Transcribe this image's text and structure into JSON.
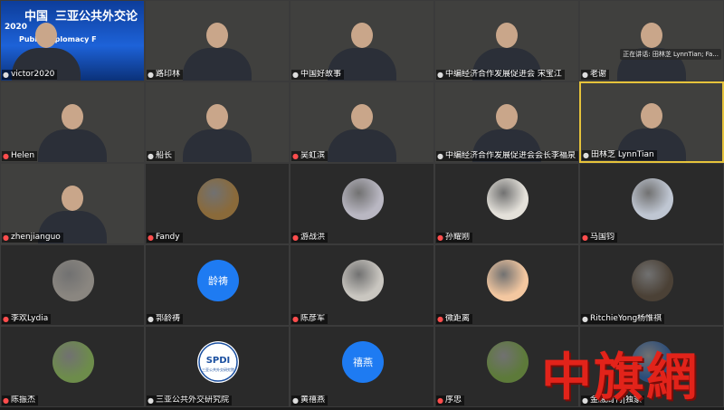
{
  "active_speaker": {
    "indicator_label": "正在讲话: 田林芝 LynnTian; Fa..."
  },
  "watermark": {
    "text": "中旗網"
  },
  "conference_banner": {
    "line1": "中国",
    "line2": "2020",
    "line3": "三亚公共外交论",
    "line4": "Public Diplomacy F"
  },
  "participants": [
    {
      "name": "victor2020",
      "kind": "banner",
      "muted": false
    },
    {
      "name": "路印林",
      "kind": "video",
      "bg": "dark",
      "muted": false
    },
    {
      "name": "中国好故事",
      "kind": "video",
      "bg": "stage",
      "muted": false
    },
    {
      "name": "中编经济合作发展促进会 宋宝江",
      "kind": "video",
      "bg": "flags",
      "muted": false
    },
    {
      "name": "老谢",
      "kind": "video",
      "bg": "outdoor",
      "muted": false
    },
    {
      "name": "Helen",
      "kind": "video",
      "bg": "light",
      "muted": true
    },
    {
      "name": "船长",
      "kind": "video",
      "bg": "office",
      "muted": false
    },
    {
      "name": "吴虹滨",
      "kind": "video",
      "bg": "shelf",
      "muted": true
    },
    {
      "name": "中编经济合作发展促进会会长李福泉",
      "kind": "video",
      "bg": "wall",
      "muted": false
    },
    {
      "name": "田林芝 LynnTian",
      "kind": "video",
      "bg": "wall",
      "muted": false,
      "active": true
    },
    {
      "name": "zhenjianguo",
      "kind": "video",
      "bg": "light",
      "muted": true
    },
    {
      "name": "Fandy",
      "kind": "avatar-image",
      "color": "#8a6a3a",
      "muted": true
    },
    {
      "name": "游战洪",
      "kind": "avatar-image",
      "color": "#b9b7c2",
      "muted": true
    },
    {
      "name": "孙耀刚",
      "kind": "avatar-image",
      "color": "#e4e1da",
      "muted": true
    },
    {
      "name": "马国钧",
      "kind": "avatar-image",
      "color": "#bfc6d2",
      "muted": true
    },
    {
      "name": "李欢Lydia",
      "kind": "avatar-image",
      "color": "#8a8680",
      "muted": true
    },
    {
      "name": "郭龄祷",
      "kind": "avatar-text",
      "initials": "龄祷",
      "muted": false
    },
    {
      "name": "陈彦军",
      "kind": "avatar-image",
      "color": "#c9c6c0",
      "muted": true
    },
    {
      "name": "微距离",
      "kind": "avatar-image",
      "color": "#f3c7a0",
      "muted": true
    },
    {
      "name": "RitchieYong杨惟祺",
      "kind": "avatar-image",
      "color": "#4b4136",
      "muted": false
    },
    {
      "name": "陈振杰",
      "kind": "avatar-image",
      "color": "#6d8c4b",
      "muted": true
    },
    {
      "name": "三亚公共外交研究院",
      "kind": "avatar-logo",
      "logo_text": "SPDI",
      "logo_sub": "三亚公共外交研究院",
      "muted": false
    },
    {
      "name": "黄禧燕",
      "kind": "avatar-text",
      "initials": "禧燕",
      "muted": false
    },
    {
      "name": "序忠",
      "kind": "avatar-image",
      "color": "#5d7a3a",
      "muted": true
    },
    {
      "name": "金融周刊|独家",
      "kind": "avatar-image",
      "color": "#2a4d7a",
      "muted": false
    }
  ],
  "colors": {
    "active_border": "#e6c33b",
    "avatar_blue": "#1e7bf2",
    "mute_red": "#ff4d4d",
    "watermark_red": "#e2231a"
  }
}
